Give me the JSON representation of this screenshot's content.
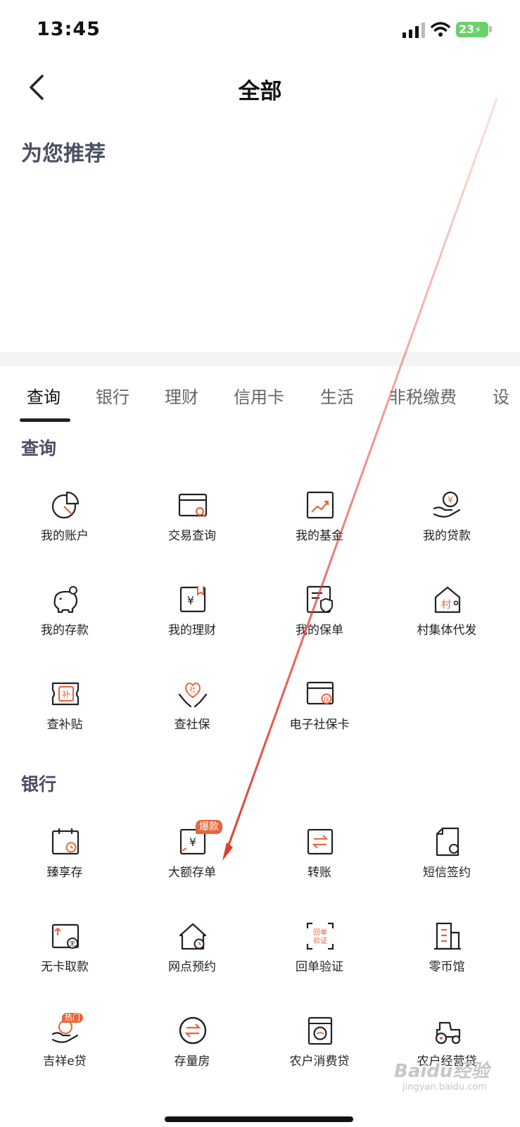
{
  "status_bar": {
    "time": "13:45",
    "battery": "23"
  },
  "nav": {
    "title": "全部"
  },
  "recommend": {
    "title": "为您推荐"
  },
  "tabs": [
    {
      "label": "查询",
      "active": true
    },
    {
      "label": "银行"
    },
    {
      "label": "理财"
    },
    {
      "label": "信用卡"
    },
    {
      "label": "生活"
    },
    {
      "label": "非税缴费"
    },
    {
      "label": "设"
    }
  ],
  "sections": {
    "query": {
      "title": "查询",
      "items": [
        {
          "label": "我的账户",
          "icon": "pie-chart-icon"
        },
        {
          "label": "交易查询",
          "icon": "card-search-icon"
        },
        {
          "label": "我的基金",
          "icon": "trend-chart-icon"
        },
        {
          "label": "我的贷款",
          "icon": "hand-coin-icon"
        },
        {
          "label": "我的存款",
          "icon": "piggy-bank-icon"
        },
        {
          "label": "我的理财",
          "icon": "bookmark-yuan-icon"
        },
        {
          "label": "我的保单",
          "icon": "policy-shield-icon"
        },
        {
          "label": "村集体代发",
          "icon": "village-house-icon"
        },
        {
          "label": "查补贴",
          "icon": "subsidy-ticket-icon"
        },
        {
          "label": "查社保",
          "icon": "social-security-heart-icon"
        },
        {
          "label": "电子社保卡",
          "icon": "social-card-icon"
        }
      ]
    },
    "bank": {
      "title": "银行",
      "items": [
        {
          "label": "臻享存",
          "icon": "calendar-clock-icon"
        },
        {
          "label": "大额存单",
          "icon": "certificate-yuan-icon",
          "badge": "爆款"
        },
        {
          "label": "转账",
          "icon": "transfer-icon"
        },
        {
          "label": "短信签约",
          "icon": "document-sms-icon"
        },
        {
          "label": "无卡取款",
          "icon": "cardless-withdraw-icon"
        },
        {
          "label": "网点预约",
          "icon": "branch-house-clock-icon"
        },
        {
          "label": "回单验证",
          "icon": "receipt-verify-icon",
          "icon_text": "回单验证"
        },
        {
          "label": "零币馆",
          "icon": "building-icon"
        },
        {
          "label": "吉祥e贷",
          "icon": "hand-loan-icon",
          "badge": "热门"
        },
        {
          "label": "存量房",
          "icon": "swap-circle-icon"
        },
        {
          "label": "农户消费贷",
          "icon": "washing-machine-icon"
        },
        {
          "label": "农户经营贷",
          "icon": "tractor-icon"
        }
      ]
    }
  },
  "watermark": {
    "brand": "Baidu经验",
    "url": "jingyan.baidu.com"
  },
  "colors": {
    "accent": "#e8643a",
    "annotation_arrow": "#e53a2f",
    "text_dark": "#222222",
    "section_title": "#4a4f63"
  }
}
